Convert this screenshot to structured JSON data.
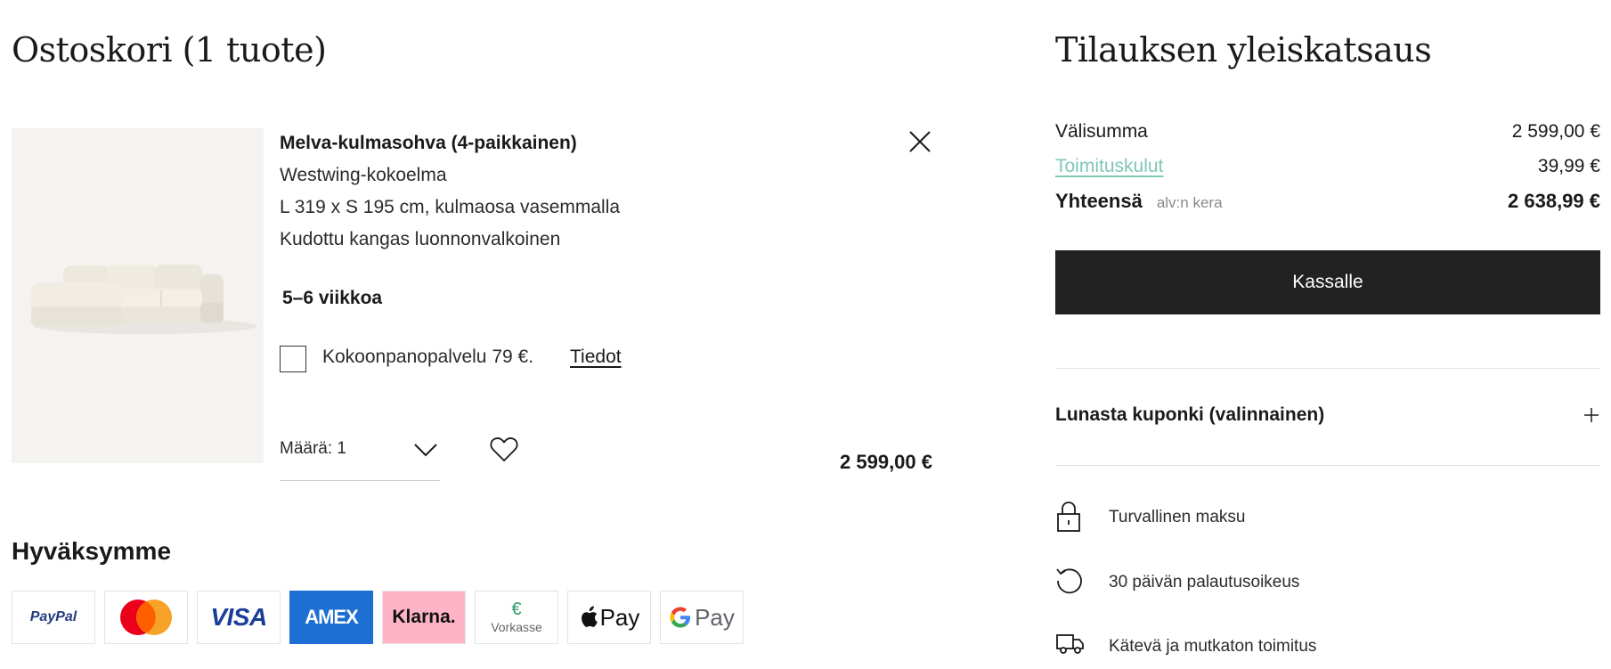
{
  "cart": {
    "title": "Ostoskori (1 tuote)",
    "item": {
      "name": "Melva-kulmasohva (4-paikkainen)",
      "collection": "Westwing-kokoelma",
      "dimensions": "L 319 x S 195 cm, kulmaosa vasemmalla",
      "material": "Kudottu kangas luonnonvalkoinen",
      "delivery_time": "5–6 viikkoa",
      "assembly_label": "Kokoonpanopalvelu 79 €.",
      "assembly_link": "Tiedot",
      "assembly_checked": false,
      "quantity_label": "Määrä: 1",
      "price": "2 599,00 €"
    }
  },
  "payment": {
    "heading": "Hyväksymme",
    "methods": [
      "PayPal",
      "Mastercard",
      "VISA",
      "AMEX",
      "Klarna.",
      "Vorkasse",
      "Pay",
      "Pay"
    ],
    "vorkasse_symbol": "€"
  },
  "summary": {
    "title": "Tilauksen yleiskatsaus",
    "subtotal_label": "Välisumma",
    "subtotal_value": "2 599,00 €",
    "shipping_label": "Toimituskulut",
    "shipping_value": "39,99 €",
    "total_label": "Yhteensä",
    "total_vat_note": "alv:n kera",
    "total_value": "2 638,99 €",
    "checkout_label": "Kassalle",
    "coupon_label": "Lunasta kuponki (valinnainen)"
  },
  "benefits": {
    "secure": "Turvallinen maksu",
    "returns": "30 päivän palautusoikeus",
    "delivery": "Kätevä ja mutkaton toimitus"
  },
  "colors": {
    "checkout_bg": "#222222",
    "link_accent": "#7fc8b6",
    "image_bg": "#f4f3f0",
    "amex_blue": "#1e6fd3",
    "klarna_pink": "#ffb3c7",
    "paypal_blue": "#253b80"
  },
  "icons": [
    "close-icon",
    "chevron-down-icon",
    "heart-icon",
    "plus-icon",
    "lock-icon",
    "return-icon",
    "truck-icon"
  ]
}
